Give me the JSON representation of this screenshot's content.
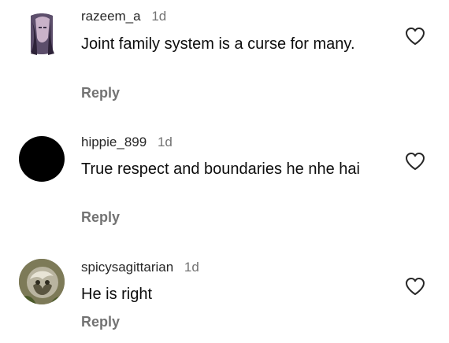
{
  "comments": [
    {
      "username": "razeem_a",
      "time": "1d",
      "text": "Joint family system is a curse for many.",
      "reply": "Reply",
      "like_icon": "heart-outline-icon",
      "avatar": "profile-photo"
    },
    {
      "username": "hippie_899",
      "time": "1d",
      "text": "True respect and boundaries he nhe hai",
      "reply": "Reply",
      "like_icon": "heart-outline-icon",
      "avatar": "black-circle"
    },
    {
      "username": "spicysagittarian",
      "time": "1d",
      "text": "He is right",
      "reply": "Reply",
      "like_icon": "heart-outline-icon",
      "avatar": "profile-photo"
    }
  ],
  "colors": {
    "username": "#262626",
    "secondary_text": "#737373",
    "body_text": "#0d0d0d",
    "background": "#ffffff"
  }
}
